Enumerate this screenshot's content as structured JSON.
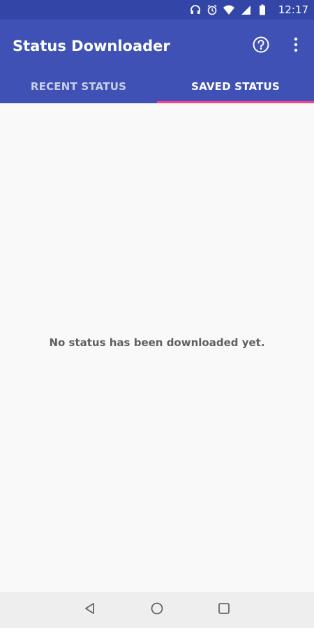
{
  "status_bar": {
    "time": "12:17",
    "icons": [
      "headphones-icon",
      "alarm-icon",
      "wifi-icon",
      "signal-icon",
      "battery-icon"
    ]
  },
  "app_bar": {
    "title": "Status Downloader",
    "actions": [
      "help-icon",
      "overflow-menu-icon"
    ]
  },
  "tabs": [
    {
      "label": "RECENT STATUS",
      "selected": false
    },
    {
      "label": "SAVED STATUS",
      "selected": true
    }
  ],
  "content": {
    "empty_message": "No status has been downloaded yet."
  },
  "nav_bar": {
    "buttons": [
      "back-icon",
      "home-icon",
      "recents-icon"
    ]
  },
  "colors": {
    "primary": "#3f51b5",
    "primary_dark": "#3346a8",
    "accent": "#ff4081",
    "background": "#f9f9f9"
  }
}
